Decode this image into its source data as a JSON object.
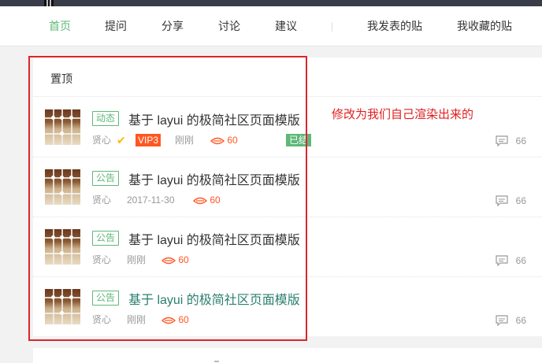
{
  "nav": {
    "items": [
      {
        "label": "首页",
        "active": true
      },
      {
        "label": "提问"
      },
      {
        "label": "分享"
      },
      {
        "label": "讨论"
      },
      {
        "label": "建议"
      }
    ],
    "right": [
      {
        "label": "我发表的贴"
      },
      {
        "label": "我收藏的贴"
      }
    ]
  },
  "panel": {
    "title": "置顶",
    "posts": [
      {
        "tag": "动态",
        "title": "基于 layui 的极简社区页面模版",
        "author": "贤心",
        "vip": "VIP3",
        "time": "刚刚",
        "views": "60",
        "status": "已结",
        "comments": "66"
      },
      {
        "tag": "公告",
        "title": "基于 layui 的极简社区页面模版",
        "author": "贤心",
        "time": "2017-11-30",
        "views": "60",
        "comments": "66"
      },
      {
        "tag": "公告",
        "title": "基于 layui 的极简社区页面模版",
        "author": "贤心",
        "time": "刚刚",
        "views": "60",
        "comments": "66"
      },
      {
        "tag": "公告",
        "title": "基于 layui 的极简社区页面模版",
        "author": "贤心",
        "time": "刚刚",
        "views": "60",
        "comments": "66"
      }
    ]
  },
  "annotation": "修改为我们自己渲染出来的",
  "colors": {
    "accent": "#5fb878",
    "vip": "#ff5722",
    "topbar": "#393d49",
    "annotation": "#e02020"
  }
}
